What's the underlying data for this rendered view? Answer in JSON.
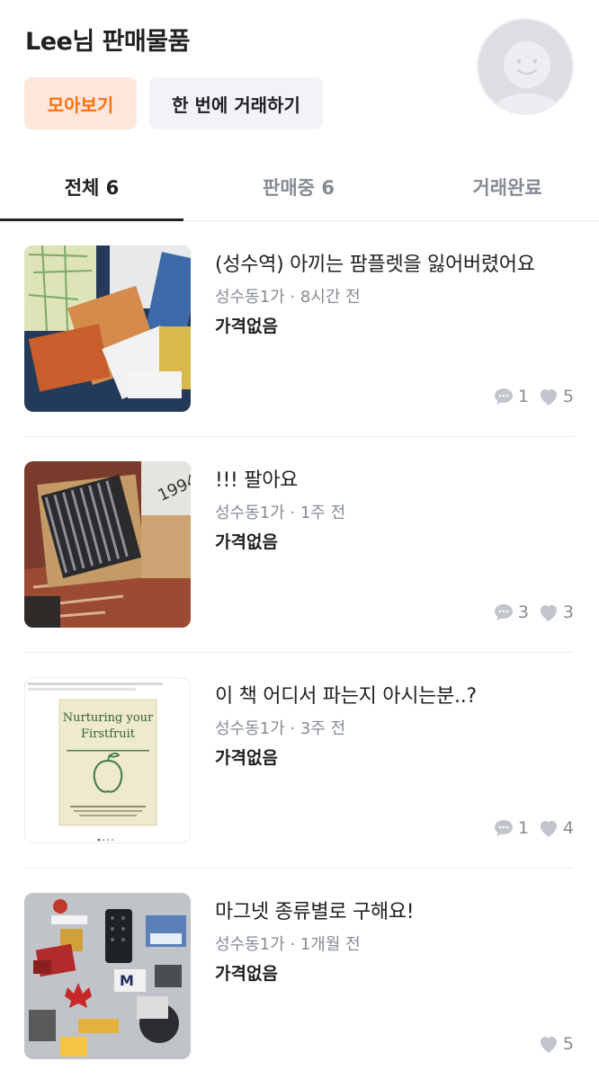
{
  "header": {
    "title": "Lee님 판매물품",
    "collect_button": "모아보기",
    "bundle_button": "한 번에 거래하기"
  },
  "tabs": [
    {
      "label": "전체 6",
      "selected": true
    },
    {
      "label": "판매중 6",
      "selected": false
    },
    {
      "label": "거래완료",
      "selected": false
    }
  ],
  "items": [
    {
      "title": "(성수역) 아끼는 팜플렛을 잃어버렸어요",
      "meta": "성수동1가 · 8시간 전",
      "price": "가격없음",
      "chats": "1",
      "likes": "5",
      "image": "pamphlets-photo"
    },
    {
      "title": "!!! 팔아요",
      "meta": "성수동1가 · 1주 전",
      "price": "가격없음",
      "chats": "3",
      "likes": "3",
      "image": "cd-box-photo"
    },
    {
      "title": "이 책 어디서 파는지 아시는분..?",
      "meta": "성수동1가 · 3주 전",
      "price": "가격없음",
      "chats": "1",
      "likes": "4",
      "image": "book-photo"
    },
    {
      "title": "마그넷 종류별로 구해요!",
      "meta": "성수동1가 · 1개월 전",
      "price": "가격없음",
      "chats": "",
      "likes": "5",
      "image": "fridge-magnets-photo"
    }
  ],
  "book_cover": {
    "title_line1": "Nurturing your",
    "title_line2": "Firstfruit"
  },
  "colors": {
    "accent": "#ff6f0f",
    "accent_bg": "#fde7da",
    "muted": "#868b94",
    "icon": "#c1c5cb"
  }
}
